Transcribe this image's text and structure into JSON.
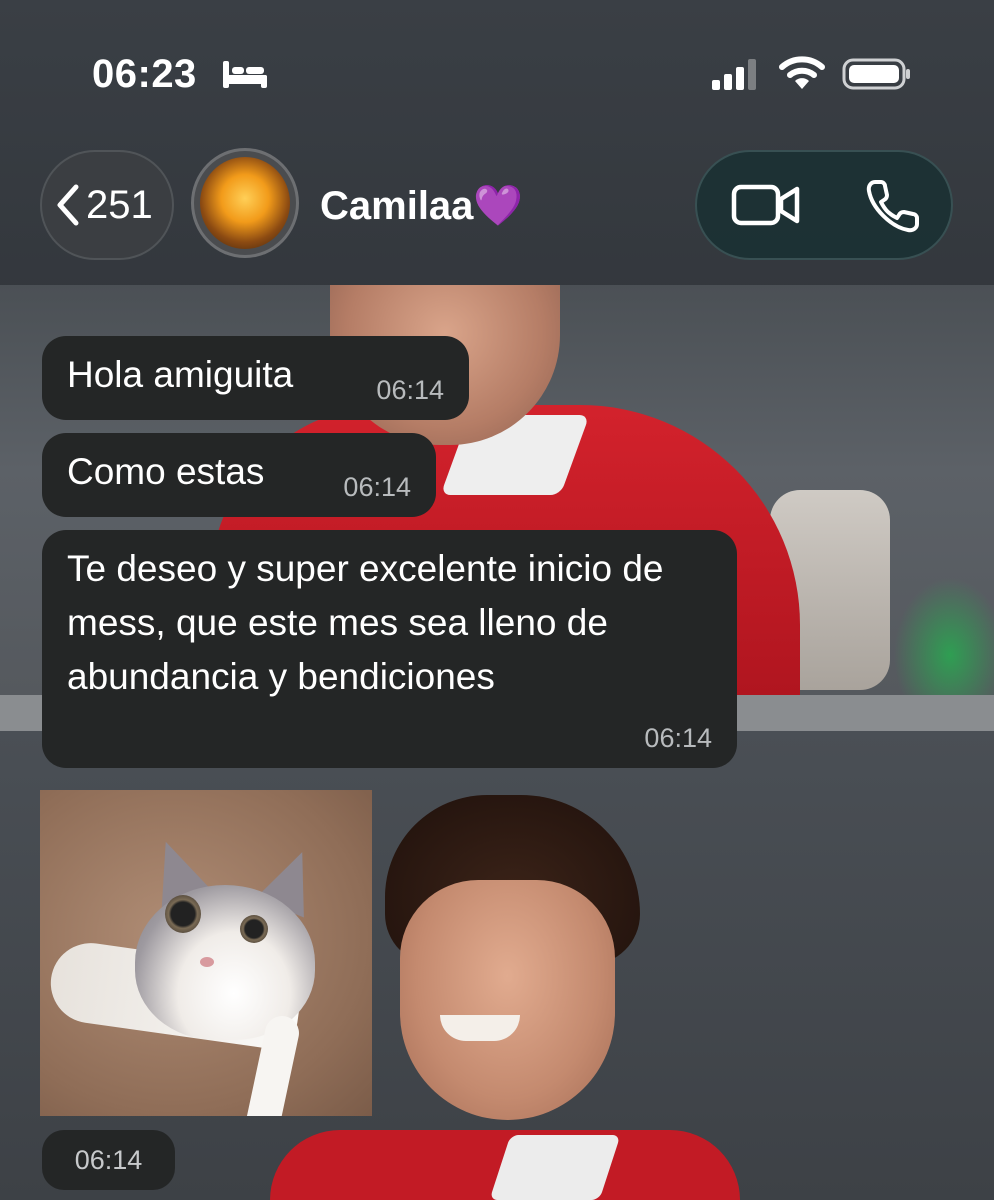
{
  "status_bar": {
    "time": "06:23",
    "icons": [
      "bed-icon",
      "signal-icon",
      "wifi-icon",
      "battery-icon"
    ]
  },
  "header": {
    "back_count": "251",
    "contact_name": "Camilaa💜",
    "actions": [
      "video-call-icon",
      "phone-icon"
    ]
  },
  "messages": [
    {
      "text": "Hola amiguita",
      "time": "06:14"
    },
    {
      "text": "Como estas",
      "time": "06:14"
    },
    {
      "text": "Te deseo y super excelente inicio de mess, que este mes sea lleno de abundancia y bendiciones",
      "time": "06:14"
    }
  ],
  "media_message": {
    "type": "photo",
    "time": "06:14"
  },
  "colors": {
    "bubble": "#242626",
    "timestamp": "#b8bbbd",
    "call_pill": "#193032"
  }
}
